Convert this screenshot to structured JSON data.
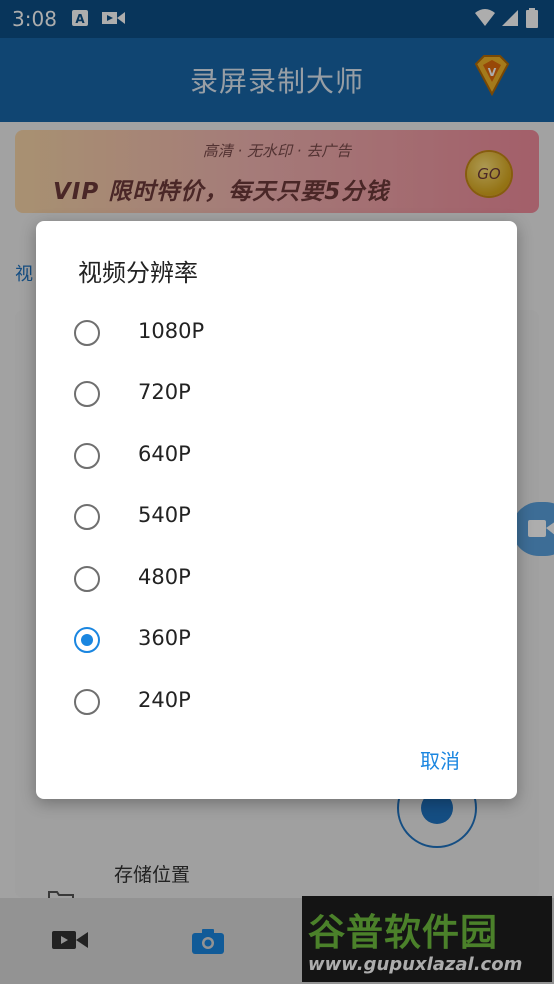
{
  "statusbar": {
    "time": "3:08"
  },
  "appbar": {
    "title": "录屏录制大师"
  },
  "banner": {
    "subtitle": "高清 · 无水印 · 去广告",
    "headline": "VIP 限时特价，每天只要5分钱",
    "go": "GO"
  },
  "content": {
    "partial_label": "视",
    "storage_label": "存储位置"
  },
  "dialog": {
    "title": "视频分辨率",
    "options": [
      {
        "label": "1080P",
        "selected": false
      },
      {
        "label": "720P",
        "selected": false
      },
      {
        "label": "640P",
        "selected": false
      },
      {
        "label": "540P",
        "selected": false
      },
      {
        "label": "480P",
        "selected": false
      },
      {
        "label": "360P",
        "selected": true
      },
      {
        "label": "240P",
        "selected": false
      }
    ],
    "cancel": "取消"
  },
  "watermark": {
    "brand": "谷普软件园",
    "url": "www.gupuxlazal.com"
  },
  "colors": {
    "primary": "#1866a8",
    "accent": "#1a86e0",
    "statusbar": "#0c4f86"
  }
}
